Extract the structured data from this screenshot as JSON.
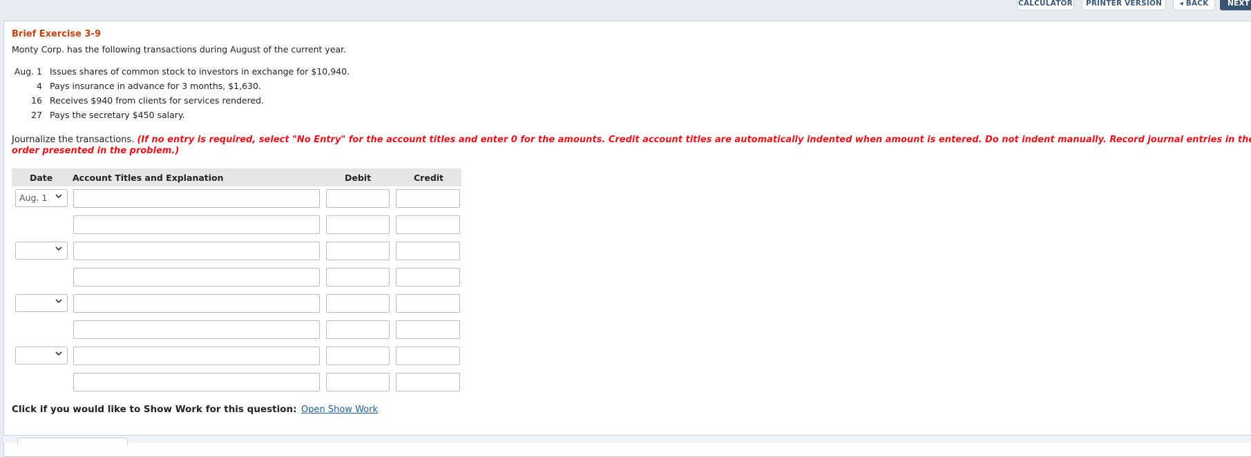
{
  "toolbar": {
    "calculator": "CALCULATOR",
    "printer_version": "PRINTER VERSION",
    "back": "BACK",
    "next": "NEXT"
  },
  "exercise": {
    "title": "Brief Exercise 3-9",
    "intro": "Monty Corp. has the following transactions during August of the current year."
  },
  "transactions": [
    {
      "date": "Aug. 1",
      "text": "Issues shares of common stock to investors in exchange for $10,940."
    },
    {
      "date": "4",
      "text": "Pays insurance in advance for 3 months, $1,630."
    },
    {
      "date": "16",
      "text": "Receives $940 from clients for services rendered."
    },
    {
      "date": "27",
      "text": "Pays the secretary $450 salary."
    }
  ],
  "instructions": {
    "lead": "Journalize the transactions.",
    "note": "(If no entry is required, select \"No Entry\" for the account titles and enter 0 for the amounts. Credit account titles are automatically indented when amount is entered. Do not indent manually. Record journal entries in the order presented in the problem.)"
  },
  "journal": {
    "headers": {
      "date": "Date",
      "account": "Account Titles and Explanation",
      "debit": "Debit",
      "credit": "Credit"
    },
    "entries": [
      {
        "date": "Aug. 1"
      },
      {
        "date": ""
      },
      {
        "date": ""
      },
      {
        "date": ""
      }
    ]
  },
  "show_work": {
    "prompt": "Click if you would like to Show Work for this question:",
    "link": "Open Show Work"
  },
  "colors": {
    "title": "#c8420f",
    "instruction_note": "#e4141b",
    "link": "#1f5e9e",
    "next_button": "#3a5472"
  }
}
